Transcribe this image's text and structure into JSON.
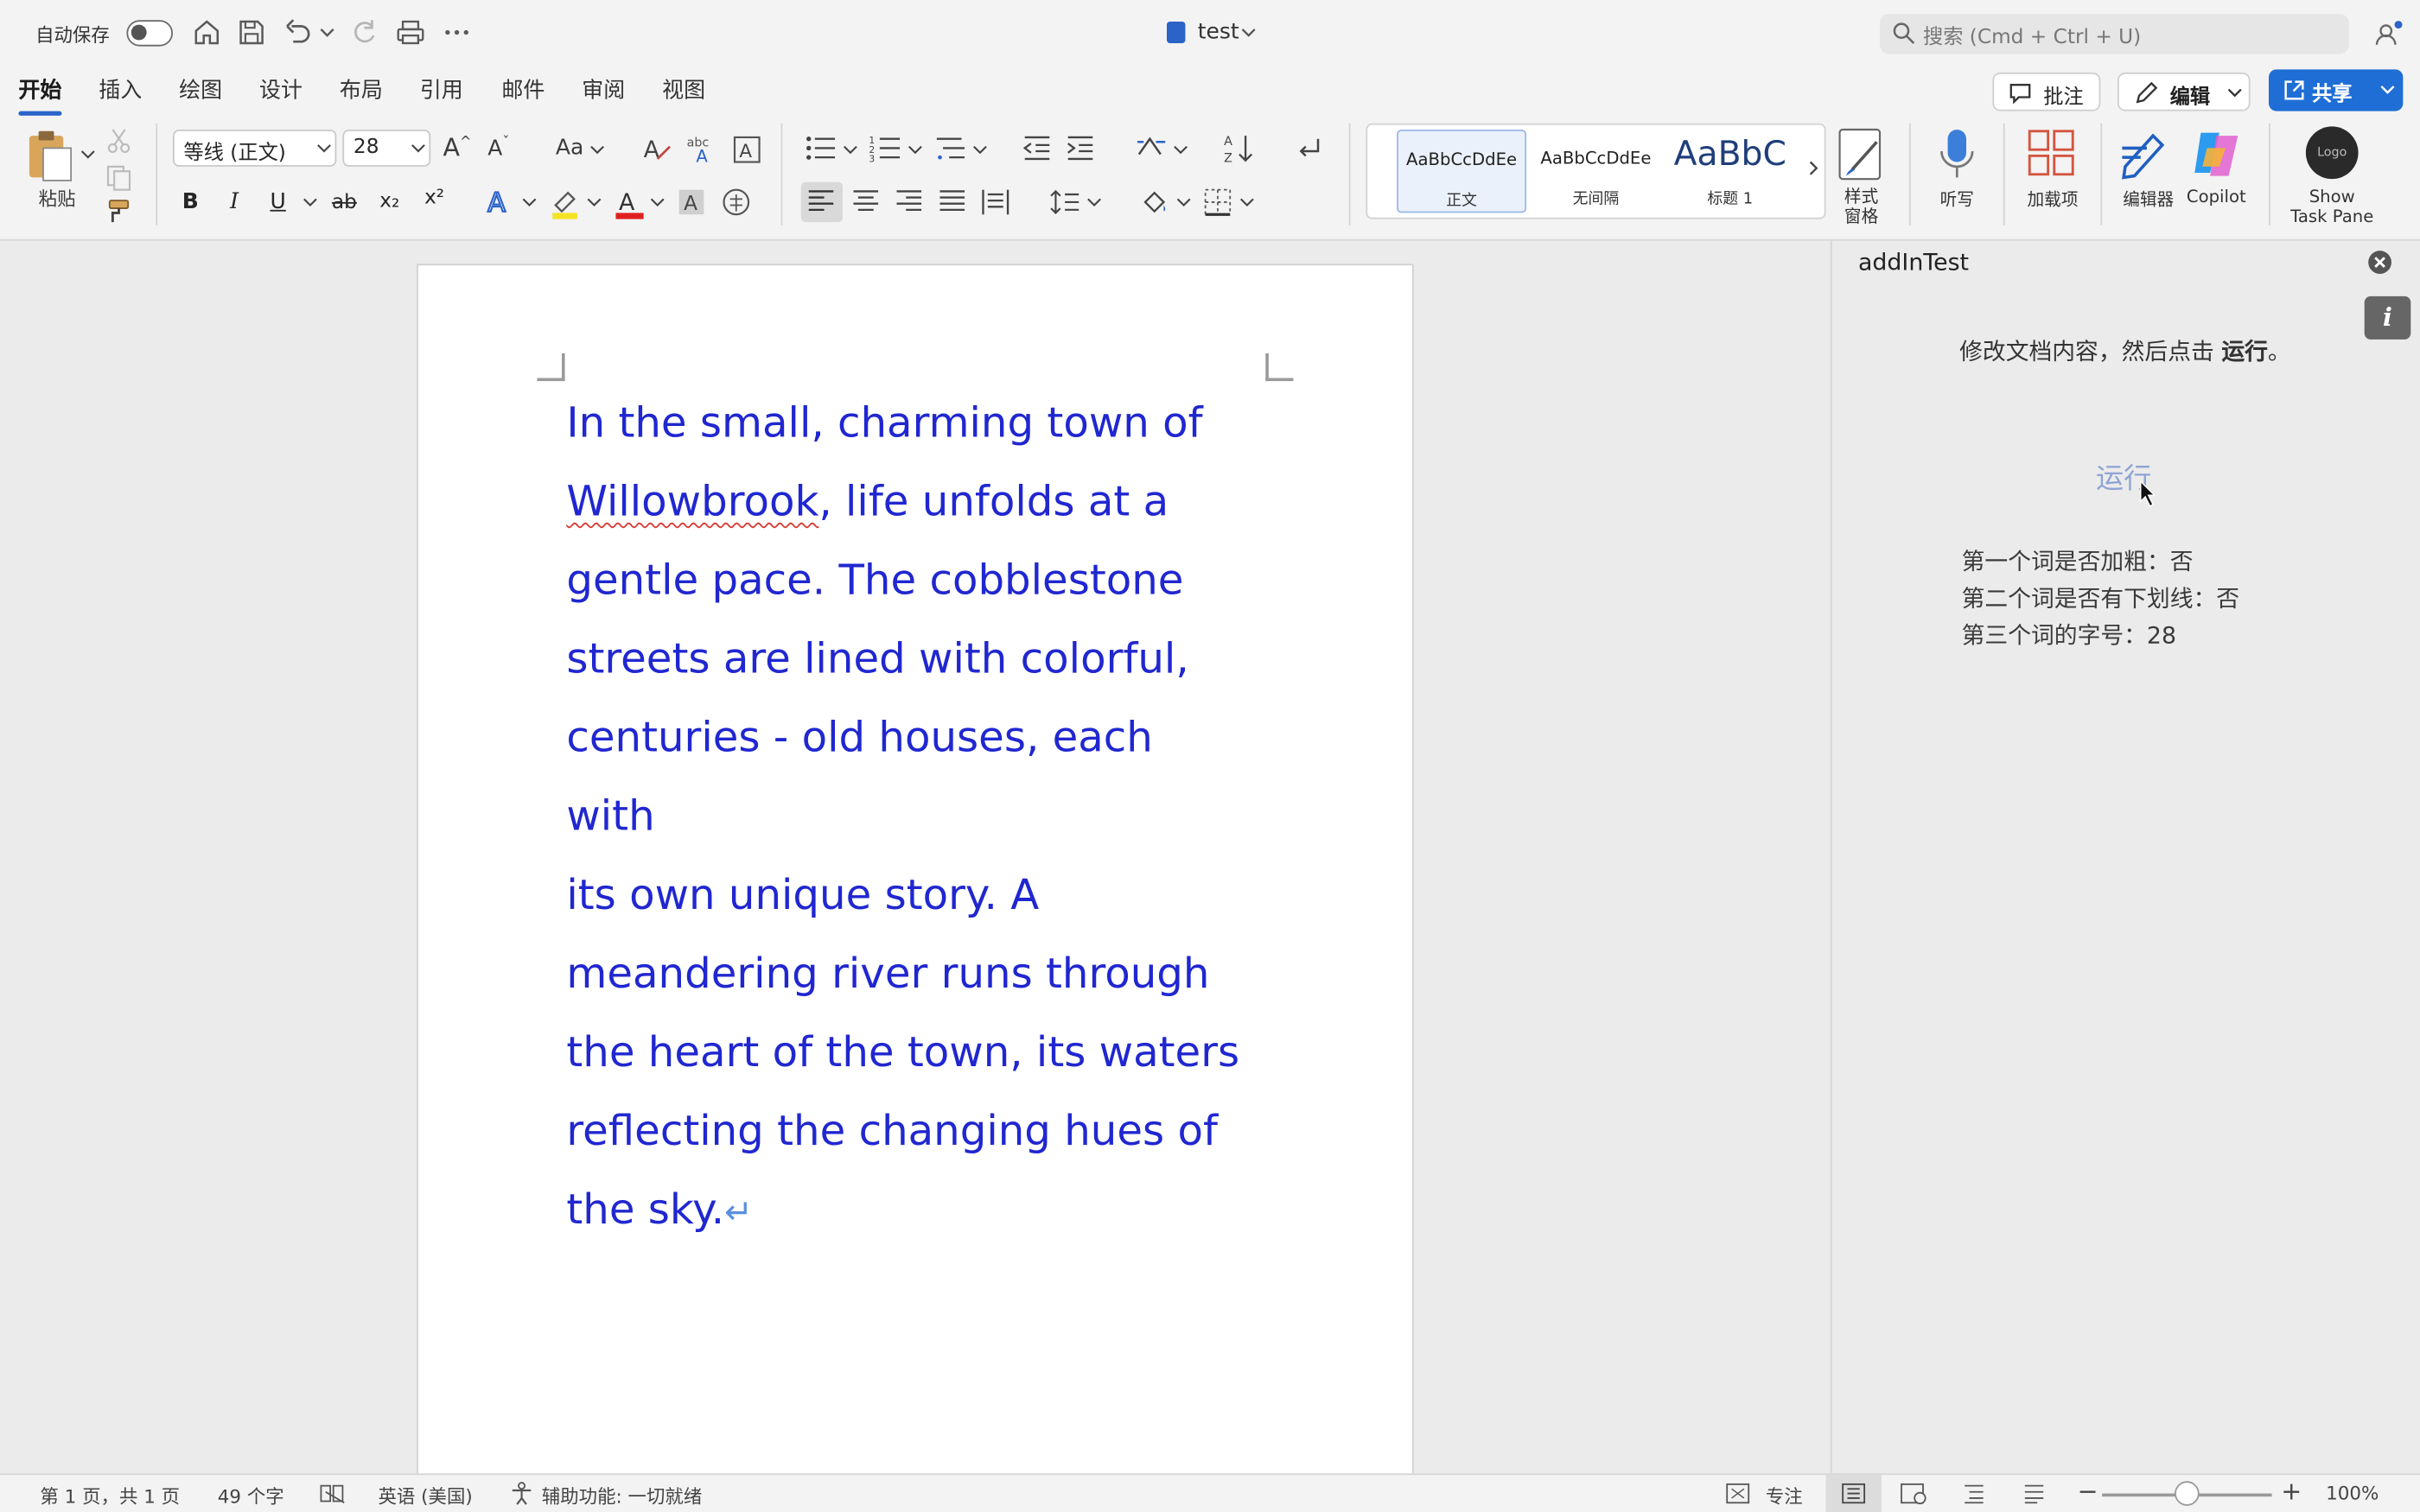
{
  "titlebar": {
    "autosave_label": "自动保存",
    "doc_title": "test",
    "search_placeholder": "搜索 (Cmd + Ctrl + U)"
  },
  "tabs": [
    "开始",
    "插入",
    "绘图",
    "设计",
    "布局",
    "引用",
    "邮件",
    "审阅",
    "视图"
  ],
  "top_buttons": {
    "comment": "批注",
    "edit": "编辑",
    "share": "共享"
  },
  "ribbon": {
    "paste_label": "粘贴",
    "font_name": "等线 (正文)",
    "font_size": "28",
    "case_label": "Aa",
    "bold": "B",
    "italic": "I",
    "underline": "U",
    "strike": "ab",
    "subscript": "x₂",
    "superscript": "x²",
    "styles": [
      {
        "preview": "AaBbCcDdEe",
        "label": "正文"
      },
      {
        "preview": "AaBbCcDdEe",
        "label": "无间隔"
      },
      {
        "preview": "AaBbC",
        "label": "标题 1"
      }
    ],
    "style_pane_label": "样式\n窗格",
    "style_pane_line1": "样式",
    "style_pane_line2": "窗格",
    "dictate_label": "听写",
    "addins_label": "加载项",
    "editor_label": "编辑器",
    "copilot_label": "Copilot",
    "show_taskpane_line1": "Show",
    "show_taskpane_line2": "Task Pane",
    "logo_text": "Logo"
  },
  "document": {
    "misspelled_word": "Willowbrook",
    "lines": [
      "In the small, charming town of",
      ", life unfolds at a",
      "gentle pace. The cobblestone",
      "streets are lined with colorful,",
      "centuries - old houses, each with",
      "its own unique story. A",
      "meandering river runs through",
      "the heart of the town, its waters",
      "reflecting the changing hues of",
      "the sky."
    ],
    "paragraph_mark": "↵"
  },
  "taskpane": {
    "title": "addInTest",
    "instruction_prefix": "修改文档内容，然后点击 ",
    "instruction_bold": "运行",
    "instruction_suffix": "。",
    "run_button": "运行",
    "results": [
      "第一个词是否加粗：否",
      "第二个词是否有下划线：否",
      "第三个词的字号：28"
    ]
  },
  "statusbar": {
    "page_info": "第 1 页，共 1 页",
    "word_count": "49 个字",
    "language": "英语 (美国)",
    "accessibility": "辅助功能: 一切就绪",
    "focus": "专注",
    "zoom": "100%"
  },
  "colors": {
    "accent": "#1f6ed6",
    "document_text": "#2027d0",
    "run_link": "#8ea4d4"
  }
}
